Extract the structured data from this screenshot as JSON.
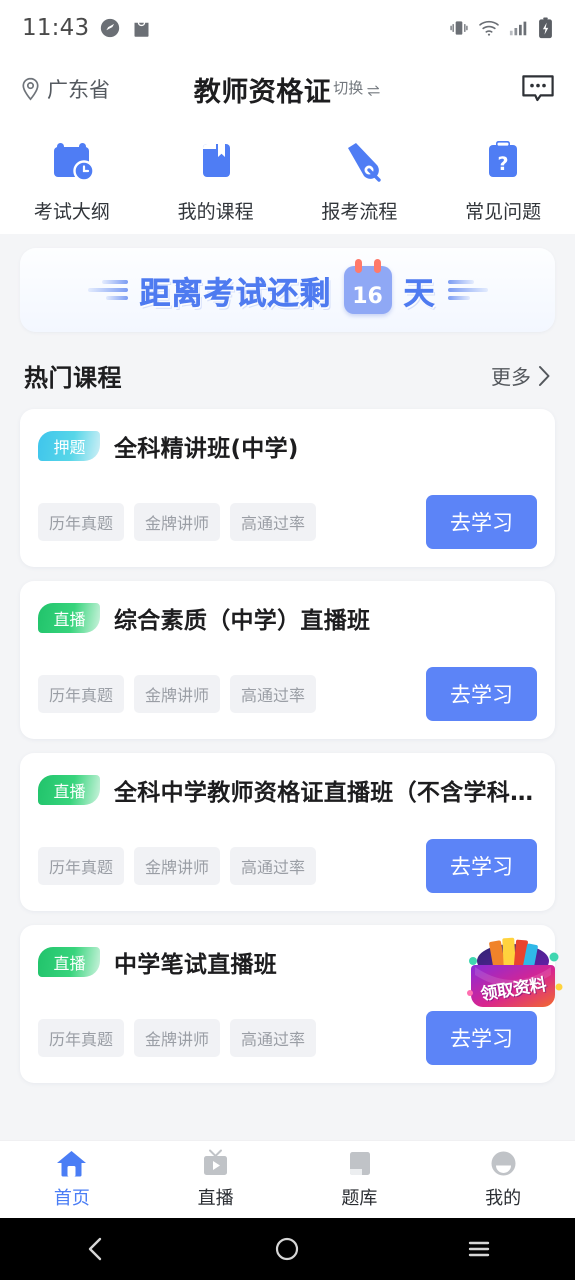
{
  "status_bar": {
    "time": "11:43",
    "left_icons": [
      "speedometer-icon",
      "bag-icon"
    ],
    "right_icons": [
      "vibrate-icon",
      "wifi-icon",
      "signal-icon",
      "battery-charging-icon"
    ]
  },
  "header": {
    "location": "广东省",
    "title": "教师资格证",
    "switch_label": "切换",
    "message_icon": "message-icon"
  },
  "quick_nav": [
    {
      "label": "考试大纲",
      "icon": "calendar-clock-icon"
    },
    {
      "label": "我的课程",
      "icon": "book-bookmark-icon"
    },
    {
      "label": "报考流程",
      "icon": "pen-nib-icon"
    },
    {
      "label": "常见问题",
      "icon": "clipboard-question-icon"
    }
  ],
  "banner": {
    "prefix": "距离考试还剩",
    "days": "16",
    "suffix": "天"
  },
  "section": {
    "title": "热门课程",
    "more_label": "更多"
  },
  "courses": [
    {
      "badge": "押题",
      "badge_color": "#3fc5ec",
      "badge_style": "cyan",
      "title": "全科精讲班(中学)",
      "tags": [
        "历年真题",
        "金牌讲师",
        "高通过率"
      ],
      "action": "去学习"
    },
    {
      "badge": "直播",
      "badge_color": "#21c36b",
      "badge_style": "green",
      "title": "综合素质（中学）直播班",
      "tags": [
        "历年真题",
        "金牌讲师",
        "高通过率"
      ],
      "action": "去学习"
    },
    {
      "badge": "直播",
      "badge_color": "#21c36b",
      "badge_style": "green",
      "title": "全科中学教师资格证直播班（不含学科…",
      "tags": [
        "历年真题",
        "金牌讲师",
        "高通过率"
      ],
      "action": "去学习"
    },
    {
      "badge": "直播",
      "badge_color": "#21c36b",
      "badge_style": "green",
      "title": "中学笔试直播班",
      "tags": [
        "历年真题",
        "金牌讲师",
        "高通过率"
      ],
      "action": "去学习"
    }
  ],
  "floating_sticker": {
    "label": "领取资料",
    "icon": "gift-envelope-icon"
  },
  "tab_bar": {
    "active_color": "#4a7df5",
    "items": [
      {
        "label": "首页",
        "icon": "home-icon",
        "active": true
      },
      {
        "label": "直播",
        "icon": "tv-icon",
        "active": false
      },
      {
        "label": "题库",
        "icon": "book-icon",
        "active": false
      },
      {
        "label": "我的",
        "icon": "person-icon",
        "active": false
      }
    ]
  },
  "system_nav": {
    "back": "back-icon",
    "home": "home-circle-icon",
    "recents": "recents-icon"
  }
}
